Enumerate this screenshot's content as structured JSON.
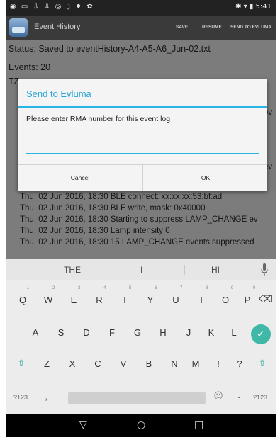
{
  "status_bar": {
    "left_icons": "◉ ▭ ⇩ ⇩ ◎ ▯ ♦ ✿",
    "right": "✱ ▾ ▮ 5:41"
  },
  "action_bar": {
    "title": "Event History",
    "save_label": "SAVE",
    "resume_label": "RESUME",
    "send_label": "SEND TO EVLUMA"
  },
  "content": {
    "status_line": "Status: Saved to eventHistory-A4-A5-A6_Jun-02.txt",
    "events_line": "Events: 20",
    "tz_line": "TZ",
    "right_clip_1": "ev",
    "right_clip_2": "ev",
    "events": [
      "Thu, 02 Jun 2016, 18:30 BLE connect: xx:xx:xx:53:bf:ad",
      "Thu, 02 Jun 2016, 18:30 BLE write, mask: 0x40000",
      "Thu, 02 Jun 2016, 18:30 Starting to suppress LAMP_CHANGE ev",
      "Thu, 02 Jun 2016, 18:30 Lamp intensity 0",
      "Thu, 02 Jun 2016, 18:30 15 LAMP_CHANGE events suppressed"
    ]
  },
  "dialog": {
    "title": "Send to Evluma",
    "message": "Please enter RMA number for this event log",
    "input_value": "",
    "cancel_label": "Cancel",
    "ok_label": "OK"
  },
  "keyboard": {
    "suggestions": [
      "THE",
      "I",
      "HI"
    ],
    "row1": [
      "Q",
      "W",
      "E",
      "R",
      "T",
      "Y",
      "U",
      "I",
      "O",
      "P"
    ],
    "row1_hints": [
      "1",
      "2",
      "3",
      "4",
      "5",
      "6",
      "7",
      "8",
      "9",
      "0"
    ],
    "row2": [
      "A",
      "S",
      "D",
      "F",
      "G",
      "H",
      "J",
      "K",
      "L"
    ],
    "row3": [
      "Z",
      "X",
      "C",
      "V",
      "B",
      "N",
      "M",
      "!",
      "?"
    ],
    "symbols_label": "?123",
    "symbols_label_right": "?123",
    "comma": ",",
    "period": ".",
    "emoji": "☺",
    "backspace": "⌫",
    "shift": "⇧",
    "enter": "✓"
  },
  "nav_bar": {
    "back": "▽",
    "home": "○",
    "recents": "□"
  }
}
